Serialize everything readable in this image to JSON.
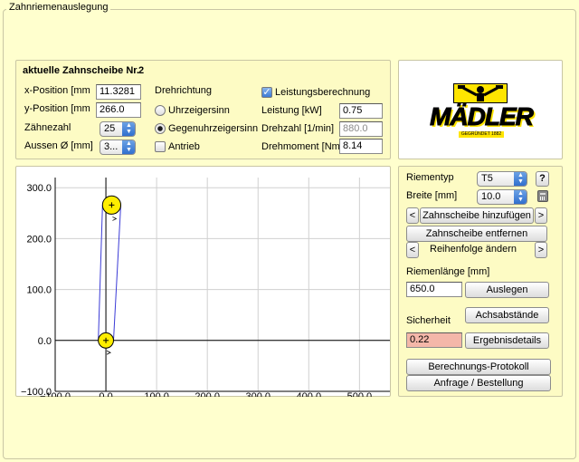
{
  "window": {
    "title": "Zahnriemenauslegung"
  },
  "pulley_panel": {
    "title": "aktuelle Zahnscheibe Nr.",
    "number": "2",
    "x_label": "x-Position [mm",
    "x_value": "11.3281",
    "y_label": "y-Position [mm",
    "y_value": "266.0",
    "teeth_label": "Zähnezahl",
    "teeth_value": "25",
    "outer_label": "Aussen Ø [mm]",
    "outer_value": "3...",
    "direction_label": "Drehrichtung",
    "cw_label": "Uhrzeigersinn",
    "ccw_label": "Gegenuhrzeigersinn",
    "drive_label": "Antrieb",
    "power_calc_label": "Leistungsberechnung",
    "power_label": "Leistung [kW]",
    "power_value": "0.75",
    "speed_label": "Drehzahl [1/min]",
    "speed_value": "880.0",
    "torque_label": "Drehmoment [Nm",
    "torque_value": "8.14"
  },
  "logo": {
    "text": "MÄDLER",
    "subtext": "GEGRÜNDET 1882"
  },
  "belt_panel": {
    "type_label": "Riementyp",
    "type_value": "T5",
    "help_label": "?",
    "width_label": "Breite [mm]",
    "width_value": "10.0",
    "prev_label": "<",
    "next_label": ">",
    "add_pulley_label": "Zahnscheibe hinzufügen",
    "remove_pulley_label": "Zahnscheibe entfernen",
    "order_label": "Reihenfolge ändern",
    "length_label": "Riemenlänge [mm]",
    "length_value": "650.0",
    "design_button": "Auslegen",
    "safety_label": "Sicherheit",
    "distances_button": "Achsabstände",
    "safety_value": "0.22",
    "results_button": "Ergebnisdetails",
    "protocol_button": "Berechnungs-Protokoll",
    "order_button": "Anfrage / Bestellung"
  },
  "colors": {
    "background": "#ffffce",
    "pulley_fill": "#ffee00",
    "belt": "#3b3bd6",
    "pink_field": "#f4b7a9"
  },
  "chart_data": {
    "type": "scatter",
    "x_ticks": [
      "−100.0",
      "0.0",
      "100.0",
      "200.0",
      "300.0",
      "400.0",
      "500.0"
    ],
    "y_ticks": [
      "300.0",
      "200.0",
      "100.0",
      "0.0",
      "−100.0"
    ],
    "xlim": [
      -100,
      560
    ],
    "ylim": [
      -100,
      320
    ],
    "grid": true,
    "pulleys": [
      {
        "x": 0.0,
        "y": 0.0,
        "diameter": 30
      },
      {
        "x": 11.3281,
        "y": 266.0,
        "diameter": 36
      }
    ]
  }
}
